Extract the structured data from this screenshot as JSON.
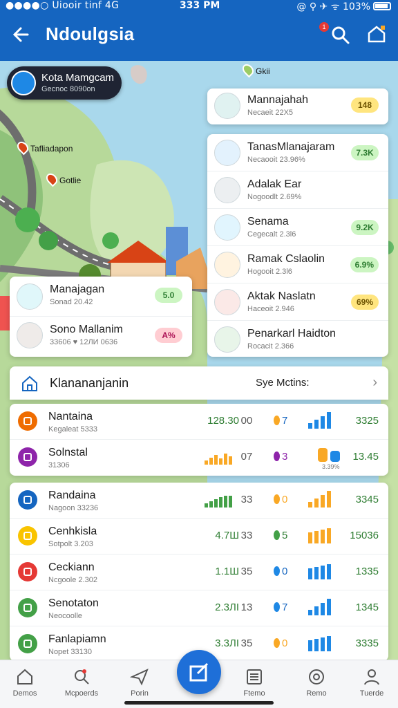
{
  "status_bar": {
    "left": "●●●●○ Uiooir tinf  4G",
    "time": "333 PM",
    "right": "@ ⚲ ✈ ᯤ 103%"
  },
  "app_bar": {
    "title": "Ndoulgsia",
    "notification_count": "1"
  },
  "map": {
    "badge_title": "Kota Mamgcam",
    "badge_sub": "Gecnoc 8090on",
    "pin_top": "Gkii",
    "pin_1": "Tafliadapon",
    "pin_2": "Gotlie"
  },
  "top_card": {
    "name": "Mannajahah",
    "sub": "Necaeit 22X5",
    "value": "148",
    "tone": "yellow"
  },
  "right_card": [
    {
      "name": "TanasMlanajaram",
      "sub": "Necaooit 23.96%",
      "value": "7.3K",
      "tone": "green"
    },
    {
      "name": "Adalak Ear",
      "sub": "Nogoodlt 2.69%",
      "value": "",
      "tone": ""
    },
    {
      "name": "Senama",
      "sub": "Cegecalt 2.3l6",
      "value": "9.2K",
      "tone": "green"
    },
    {
      "name": "Ramak Cslaolin",
      "sub": "Hogooit 2.3l6",
      "value": "6.9%",
      "tone": "green"
    },
    {
      "name": "Aktak Naslatn",
      "sub": "Haceoit 2.946",
      "value": "69%",
      "tone": "yellow"
    },
    {
      "name": "Penarkarl Haidton",
      "sub": "Rocacit 2.366",
      "value": "",
      "tone": ""
    }
  ],
  "left_card": [
    {
      "name": "Manajagan",
      "sub": "Sonad 20.42",
      "value": "5.0",
      "tone": "green"
    },
    {
      "name": "Sono Mallanim",
      "sub": "33606  ♥ 12ЛИ 0636",
      "value": "A%",
      "tone": "pink"
    }
  ],
  "summary": {
    "title": "Klanananjanin",
    "sort_label": "Sye Mctins:"
  },
  "list_a": [
    {
      "name": "Nantaina",
      "sub": "Kegaleat 5333",
      "v1": "128.30",
      "v2": "00",
      "v3": "7",
      "v4": "3325",
      "color": "#ef6c00",
      "bar_color": "#1e88e5"
    },
    {
      "name": "Solnstal",
      "sub": "31306",
      "v1": "",
      "v2": "07",
      "v3": "3",
      "v4": "13.45",
      "color": "#8e24aa",
      "bar_color": "#1e88e5",
      "extra": "3.39%"
    }
  ],
  "list_b": [
    {
      "name": "Randaina",
      "sub": "Nagoon 33236",
      "v1": "",
      "v2": "33",
      "v3": "0",
      "v4": "3345",
      "color": "#1565c0",
      "bar_color": "#f9a825"
    },
    {
      "name": "Cenhkisla",
      "sub": "Sotpolt 3.203",
      "v1": "4.7Ш",
      "v2": "33",
      "v3": "5",
      "v4": "15036",
      "color": "#f9c400",
      "bar_color": "#f9a825"
    },
    {
      "name": "Ceckiann",
      "sub": "Ncgoole 2.302",
      "v1": "1.1Ш",
      "v2": "35",
      "v3": "0",
      "v4": "1335",
      "color": "#e53935",
      "bar_color": "#1e88e5"
    },
    {
      "name": "Senotaton",
      "sub": "Neocoolle",
      "v1": "2.3ЛІ",
      "v2": "13",
      "v3": "7",
      "v4": "1345",
      "color": "#43a047",
      "bar_color": "#1e88e5"
    },
    {
      "name": "Fanlapiamn",
      "sub": "Nopet 33130",
      "v1": "3.3ЛІ",
      "v2": "35",
      "v3": "0",
      "v4": "3335",
      "color": "#43a047",
      "bar_color": "#1e88e5"
    }
  ],
  "bottom_nav": [
    {
      "label": "Demos",
      "icon": "home-icon"
    },
    {
      "label": "Mcpoerds",
      "icon": "search-person-icon"
    },
    {
      "label": "Porin",
      "icon": "send-icon"
    },
    {
      "label": "Ftemo",
      "icon": "list-icon"
    },
    {
      "label": "Remo",
      "icon": "circle-icon"
    },
    {
      "label": "Tuerde",
      "icon": "profile-icon"
    }
  ],
  "colors": {
    "primary": "#1565c0",
    "accent": "#1e6fd8",
    "positive": "#2e7d32"
  }
}
